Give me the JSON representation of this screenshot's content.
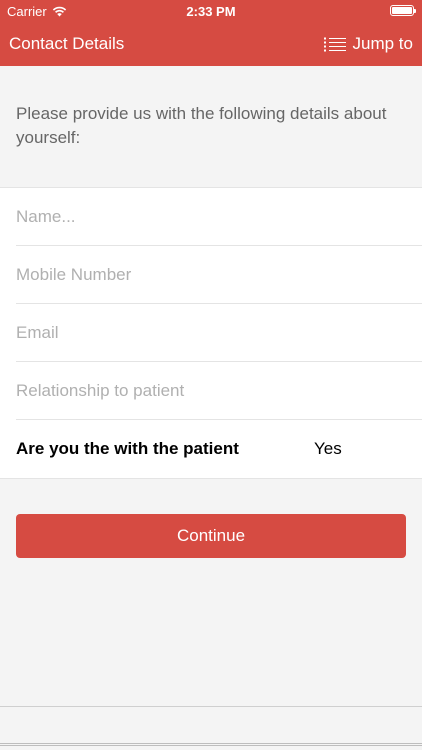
{
  "status_bar": {
    "carrier": "Carrier",
    "time": "2:33 PM",
    "battery_level": 1.0
  },
  "nav": {
    "title": "Contact Details",
    "jump_label": "Jump to",
    "jump_icon": "list-icon"
  },
  "intro_text": "Please provide us with the following details about yourself:",
  "form": {
    "name_placeholder": "Name...",
    "mobile_placeholder": "Mobile Number",
    "email_placeholder": "Email",
    "relationship_placeholder": "Relationship to patient",
    "with_patient_question": "Are you the with the patient",
    "with_patient_answer": "Yes"
  },
  "continue_label": "Continue",
  "colors": {
    "accent": "#d64b42",
    "background": "#f4f4f4"
  }
}
